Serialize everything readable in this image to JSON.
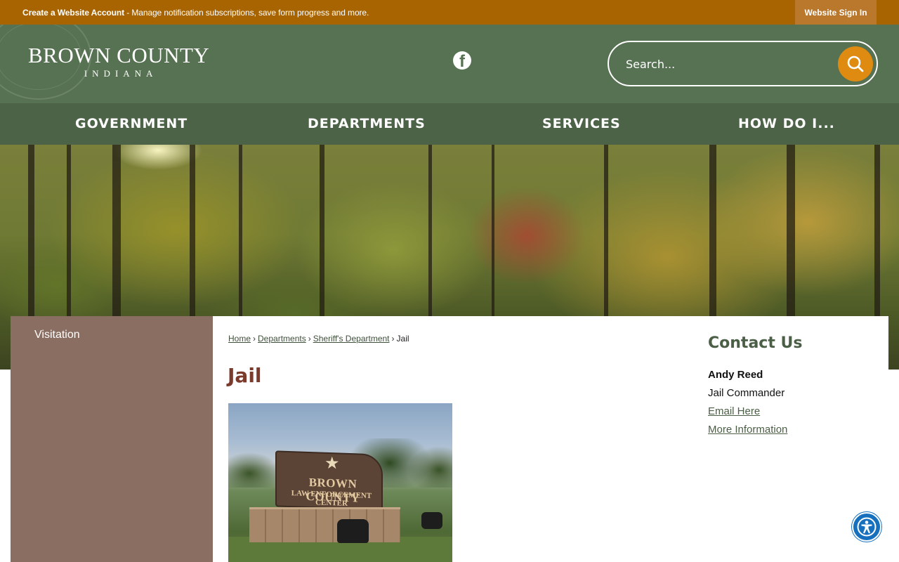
{
  "topbar": {
    "message_bold": "Create a Website Account",
    "message_rest": " - Manage notification subscriptions, save form progress and more.",
    "signin_label": "Website Sign In"
  },
  "header": {
    "logo_line1": "BROWN COUNTY",
    "logo_line2": "INDIANA",
    "social_icon": "facebook-icon",
    "search_placeholder": "Search...",
    "search_icon": "search-icon"
  },
  "nav": {
    "items": [
      {
        "label": "GOVERNMENT"
      },
      {
        "label": "DEPARTMENTS"
      },
      {
        "label": "SERVICES"
      },
      {
        "label": "HOW DO I..."
      }
    ]
  },
  "sidebar": {
    "items": [
      {
        "label": "Visitation"
      }
    ]
  },
  "breadcrumb": {
    "items": [
      "Home",
      "Departments",
      "Sheriff's Department"
    ],
    "current": "Jail",
    "separator": "›"
  },
  "page": {
    "title": "Jail"
  },
  "contact": {
    "heading": "Contact Us",
    "name": "Andy Reed",
    "role": "Jail Commander",
    "email_link": "Email Here",
    "more_link": "More Information"
  },
  "colors": {
    "topbar": "#a86400",
    "header": "#577252",
    "nav": "#4c6347",
    "sidebar": "#8b6e62",
    "title": "#7b3b2c",
    "search_button": "#df8a11",
    "accessibility": "#1670be"
  },
  "accessibility": {
    "icon": "accessibility-icon"
  }
}
